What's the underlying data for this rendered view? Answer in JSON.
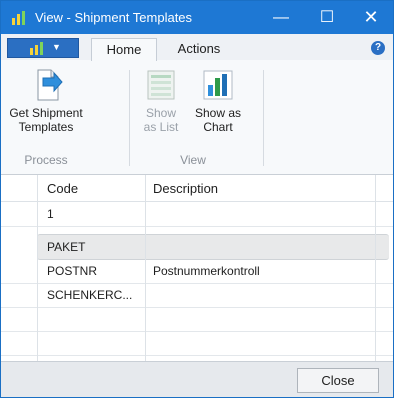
{
  "window": {
    "title": "View - Shipment Templates",
    "minimize_glyph": "—",
    "maximize_glyph": "☐",
    "close_glyph": "✕",
    "accent": "#1e78d4"
  },
  "ribbon": {
    "tabs": [
      {
        "label": "Home",
        "active": true
      },
      {
        "label": "Actions",
        "active": false
      }
    ],
    "help_glyph": "?",
    "groups": [
      {
        "label": "Process"
      },
      {
        "label": "View"
      }
    ],
    "buttons": {
      "get_shipment_templates": {
        "line1": "Get Shipment",
        "line2": "Templates",
        "icon": "import-document-icon"
      },
      "show_as_list": {
        "line1": "Show",
        "line2": "as List",
        "icon": "list-icon",
        "enabled": false
      },
      "show_as_chart": {
        "line1": "Show as",
        "line2": "Chart",
        "icon": "chart-icon"
      }
    }
  },
  "grid": {
    "columns": [
      "Code",
      "Description"
    ],
    "rows": [
      {
        "code": "1",
        "description": ""
      },
      {
        "code": "PAKET",
        "description": "",
        "selected": true
      },
      {
        "code": "POSTNR",
        "description": "Postnummerkontroll"
      },
      {
        "code": "SCHENKERC...",
        "description": ""
      },
      {
        "code": "",
        "description": ""
      },
      {
        "code": "",
        "description": ""
      }
    ]
  },
  "footer": {
    "close_label": "Close"
  }
}
